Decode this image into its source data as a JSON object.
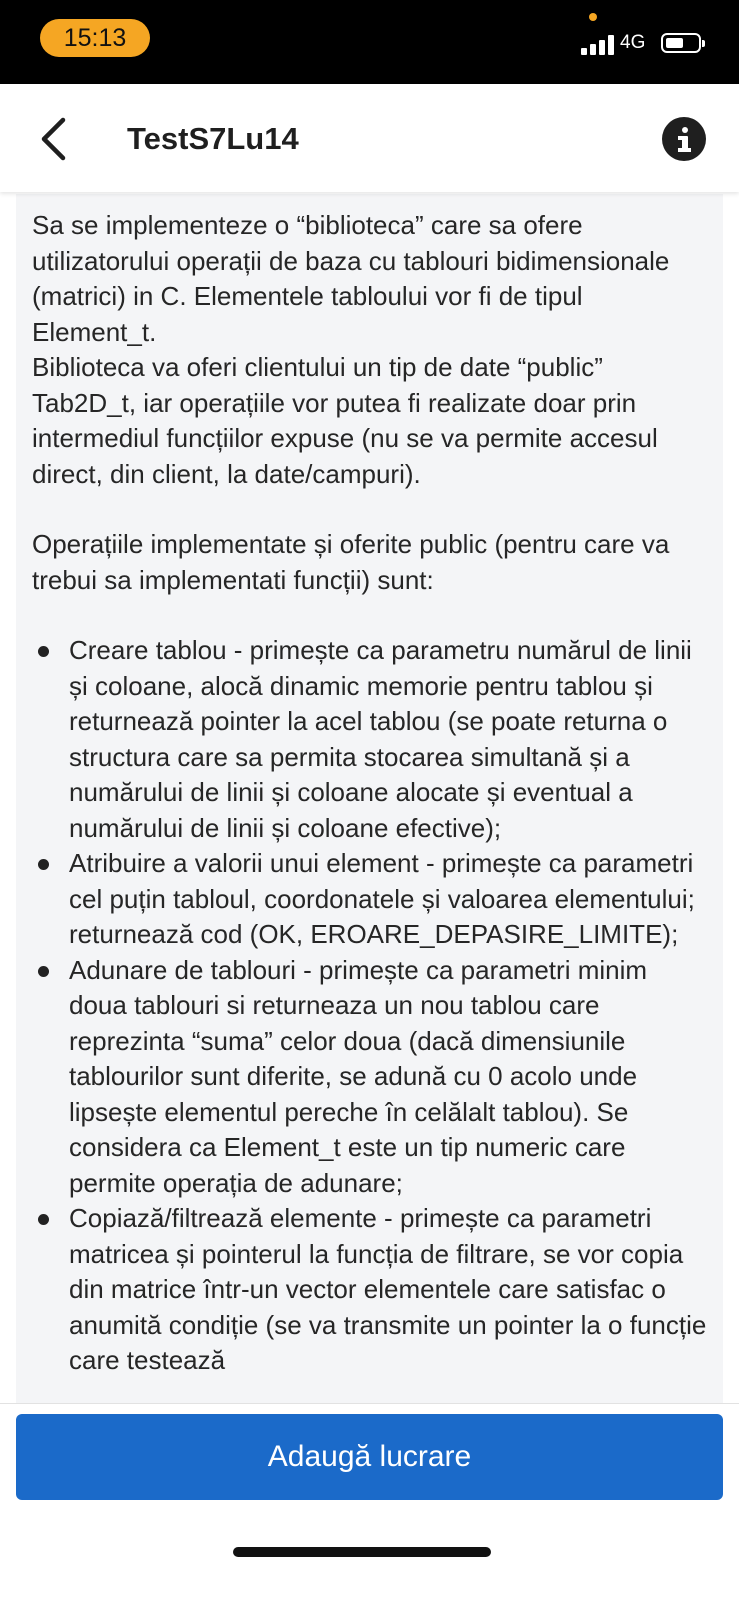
{
  "status_bar": {
    "time": "15:13",
    "network": "4G",
    "accent_color": "#f5a623"
  },
  "header": {
    "title": "TestS7Lu14",
    "back_icon": "chevron-left-icon",
    "info_icon": "info-icon"
  },
  "description": {
    "intro_1": "Sa se implementeze o “biblioteca” care sa ofere utilizatorului operații de baza cu tablouri bidimensionale (matrici) in C. Elementele tabloului vor fi de tipul Element_t.",
    "intro_2": "Biblioteca va oferi clientului un tip de date “public” Tab2D_t, iar operațiile vor putea fi realizate doar prin intermediul funcțiilor expuse (nu se va permite accesul direct, din client, la date/campuri).",
    "intro_3": "Operațiile implementate și oferite public (pentru care va trebui sa implementati funcții) sunt:",
    "bullets": [
      "Creare tablou - primește ca parametru numărul de linii și coloane, alocă dinamic memorie pentru tablou și returnează pointer la acel tablou (se poate returna o structura care sa permita stocarea simultană și a numărului de linii și coloane alocate și eventual a numărului de linii și coloane efective);",
      "Atribuire a valorii unui element - primește ca parametri cel puțin tabloul, coordonatele și valoarea elementului; returnează cod (OK, EROARE_DEPASIRE_LIMITE);",
      "Adunare de tablouri - primește ca parametri minim doua tablouri si returneaza un nou tablou care reprezinta “suma” celor doua (dacă dimensiunile tablourilor sunt diferite, se adună cu 0 acolo unde lipsește elementul pereche în celălalt tablou). Se considera ca Element_t este un tip numeric care permite operația de adunare;",
      "Copiază/filtrează elemente - primește ca parametri matricea și pointerul la funcția de filtrare, se vor copia din matrice într-un vector elementele care satisfac o anumită condiție (se va transmite un pointer la o funcție care testează"
    ]
  },
  "footer": {
    "add_button_label": "Adaugă lucrare",
    "button_color": "#1b6ac9"
  }
}
